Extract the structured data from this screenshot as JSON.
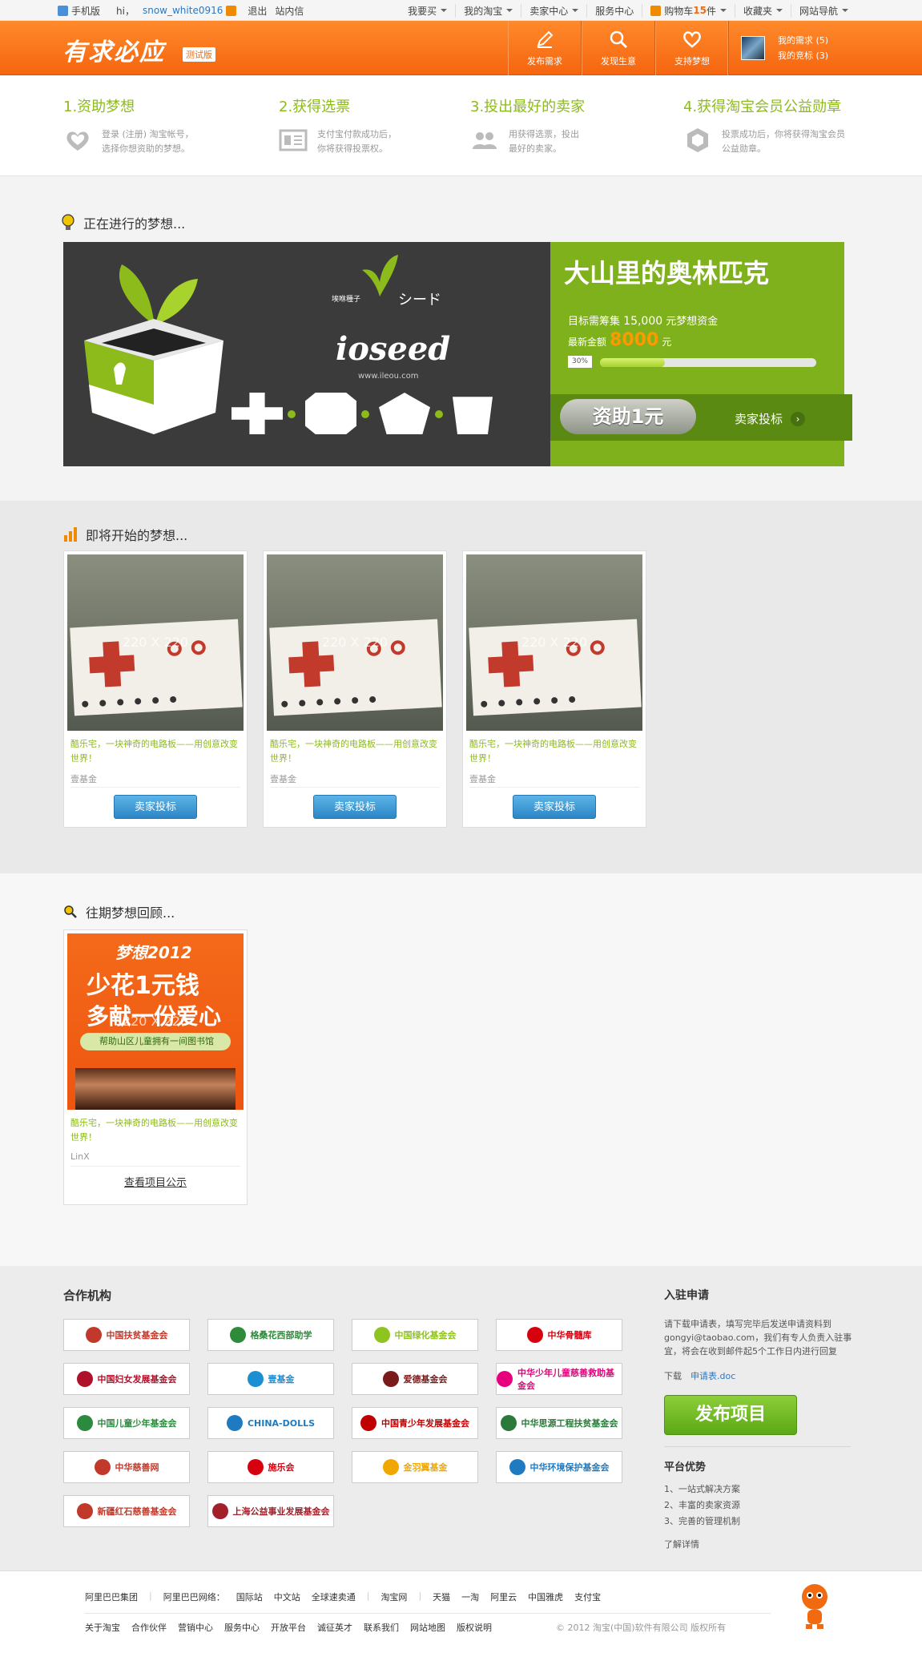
{
  "topbar": {
    "mobile": "手机版",
    "hi": "hi，",
    "username": "snow_white0916",
    "logout": "退出",
    "inbox": "站内信",
    "menu": [
      "我要买",
      "我的淘宝",
      "卖家中心",
      "服务中心",
      "购物车",
      "收藏夹",
      "网站导航"
    ],
    "cart_prefix": "购物车",
    "cart_count": "15",
    "cart_suffix": "件"
  },
  "header": {
    "logo": "有求必应",
    "logo_tag": "测试版",
    "nav": [
      "发布需求",
      "发现生意",
      "支持梦想"
    ],
    "my_needs": "我的需求 (5)",
    "my_bids": "我的竞标 (3)"
  },
  "steps": [
    {
      "title": "1.资助梦想",
      "desc1": "登录 (注册) 淘宝帐号，",
      "desc2": "选择你想资助的梦想。",
      "icon": "heart-icon"
    },
    {
      "title": "2.获得选票",
      "desc1": "支付宝付款成功后，",
      "desc2": "你将获得投票权。",
      "icon": "ticket-icon"
    },
    {
      "title": "3.投出最好的卖家",
      "desc1": "用获得选票，投出",
      "desc2": "最好的卖家。",
      "icon": "people-icon"
    },
    {
      "title": "4.获得淘宝会员公益勋章",
      "desc1": "投票成功后，你将获得淘宝会员",
      "desc2": "公益勋章。",
      "icon": "badge-icon"
    }
  ],
  "ongoing": {
    "section_title": "正在进行的梦想...",
    "banner": {
      "brand": "ioseed",
      "cn": "埃咻種子",
      "jp": "シード",
      "url": "www.ileou.com"
    },
    "title": "大山里的奥林匹克",
    "goal_prefix": "目标需筹集",
    "goal_amount": "15,000",
    "goal_suffix": "元梦想资金",
    "current_label": "最新金额",
    "current_amount": "8000",
    "current_unit": "元",
    "progress_label": "30%",
    "progress": 30,
    "fund_button": "资助1元",
    "seller_bid": "卖家投标"
  },
  "upcoming": {
    "section_title": "即将开始的梦想...",
    "cards": [
      {
        "placeholder": "220 X 220",
        "desc": "酷乐宅，一块神奇的电路板——用创意改变世界！",
        "who": "壹基金",
        "button": "卖家投标"
      },
      {
        "placeholder": "220 X 220",
        "desc": "酷乐宅，一块神奇的电路板——用创意改变世界！",
        "who": "壹基金",
        "button": "卖家投标"
      },
      {
        "placeholder": "220 X 220",
        "desc": "酷乐宅，一块神奇的电路板——用创意改变世界！",
        "who": "壹基金",
        "button": "卖家投标"
      }
    ]
  },
  "past": {
    "section_title": "往期梦想回顾...",
    "card": {
      "poster_head": "梦想2012",
      "poster_line1": "少花1元钱",
      "poster_line2": "多献一份爱心",
      "poster_strip": "帮助山区儿童拥有一间图书馆",
      "placeholder": "220 X 220",
      "desc": "酷乐宅，一块神奇的电路板——用创意改变世界！",
      "who": "LinX",
      "link": "查看项目公示"
    }
  },
  "partners": {
    "title": "合作机构",
    "logos": [
      {
        "name": "中国扶贫基金会",
        "color": "#c0392b"
      },
      {
        "name": "格桑花西部助学",
        "color": "#2e8b3a"
      },
      {
        "name": "中国绿化基金会",
        "color": "#8fc31f"
      },
      {
        "name": "中华骨髓库",
        "color": "#d7000f"
      },
      {
        "name": "中国妇女发展基金会",
        "color": "#b0112a"
      },
      {
        "name": "壹基金",
        "color": "#1b8fd2"
      },
      {
        "name": "爱德基金会",
        "color": "#7a1b1b"
      },
      {
        "name": "中华少年儿童慈善救助基金会",
        "color": "#e6007e"
      },
      {
        "name": "中国儿童少年基金会",
        "color": "#2b8a3e"
      },
      {
        "name": "CHINA-DOLLS",
        "color": "#1f7bc1"
      },
      {
        "name": "中国青少年发展基金会",
        "color": "#c00000"
      },
      {
        "name": "中华思源工程扶贫基金会",
        "color": "#2b7a3b"
      },
      {
        "name": "中华慈善网",
        "color": "#c0392b"
      },
      {
        "name": "施乐会",
        "color": "#d7000f"
      },
      {
        "name": "金羽翼基金",
        "color": "#f0a800"
      },
      {
        "name": "中华环境保护基金会",
        "color": "#1f7bc1"
      },
      {
        "name": "新疆红石慈善基金会",
        "color": "#c0392b"
      },
      {
        "name": "上海公益事业发展基金会",
        "color": "#a31f2a"
      }
    ]
  },
  "apply": {
    "title": "入驻申请",
    "text": "请下载申请表，填写完毕后发送申请资料到gongyi@taobao.com，我们有专人负责入驻事宜，将会在收到邮件起5个工作日内进行回复",
    "download_label": "下载",
    "download_link": "申请表.doc",
    "publish_button": "发布项目",
    "adv_title": "平台优势",
    "advantages": [
      "1、一站式解决方案",
      "2、丰富的卖家资源",
      "3、完善的管理机制"
    ],
    "more": "了解详情"
  },
  "footer": {
    "row1": [
      "阿里巴巴集团",
      "阿里巴巴网络：",
      "国际站",
      "中文站",
      "全球速卖通",
      "淘宝网",
      "天猫",
      "一淘",
      "阿里云",
      "中国雅虎",
      "支付宝"
    ],
    "row2": [
      "关于淘宝",
      "合作伙伴",
      "营销中心",
      "服务中心",
      "开放平台",
      "诚征英才",
      "联系我们",
      "网站地图",
      "版权说明"
    ],
    "copyright": "© 2012 淘宝(中国)软件有限公司 版权所有"
  },
  "colors": {
    "accent_orange": "#f5650f",
    "accent_green": "#7fb11c",
    "link_blue": "#2c78c2"
  }
}
